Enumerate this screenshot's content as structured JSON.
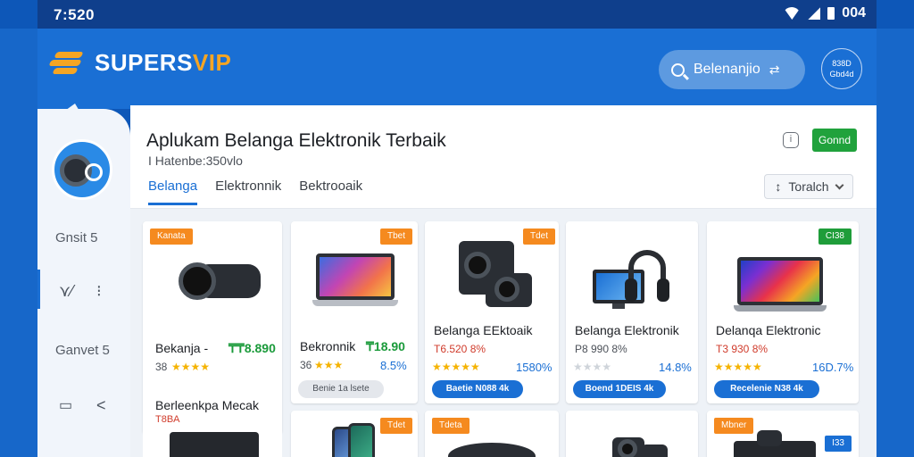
{
  "status": {
    "time": "7:520",
    "battery_text": "004"
  },
  "header": {
    "brand_a": "SUPERS",
    "brand_b": "VIP",
    "search_text": "Belenanjio",
    "account_line1": "838D",
    "account_line2": "Gbd4d"
  },
  "sidebar": {
    "item1": "Gnsit 5",
    "item2": "Ganvet 5"
  },
  "page": {
    "title": "Aplukam Belanga Elektronik Terbaik",
    "subtitle": "I Hatenbe:350vlo",
    "tabs": [
      "Belanga",
      "Elektronnik",
      "Bektrooaik"
    ],
    "action_label": "Gonnd",
    "sort_label": "Toralch"
  },
  "products": [
    {
      "badge": "Kanata",
      "name": "Bekanja -",
      "price": "₸₸8.890",
      "meta": "38",
      "stars": "★★★★"
    },
    {
      "badge": "Tbet",
      "name": "Bekronnik",
      "price": "₸18.90",
      "meta": "36",
      "stars": "★★★",
      "pct": "8.5%",
      "cta": "Benie 1a lsete"
    },
    {
      "badge": "Tdet",
      "name": "Belanga EEktoaik",
      "sub": "T6.520 8%",
      "stars": "★★★★★",
      "pct": "1580%",
      "cta": "Baetie N088 4k"
    },
    {
      "name": "Belanga Elektronik",
      "sub": "P8 990 8%",
      "stars": "★★★★",
      "pct": "14.8%",
      "cta": "Boend 1DEIS 4k"
    },
    {
      "badge": "CI38",
      "name": "Delanqa Elektronic",
      "sub": "T3 930 8%",
      "stars": "★★★★★",
      "pct": "16D.7%",
      "cta": "Recelenie N38 4k"
    },
    {
      "name": "Berleenkpa Mecak",
      "sub": "T8BA"
    },
    {
      "badge": "Tdet"
    },
    {
      "badge": "Tdeta"
    },
    {},
    {
      "badge": "Mbner",
      "badge2": "I33"
    }
  ],
  "colors": {
    "brand": "#1a6fd4",
    "accent": "#f5a524",
    "price": "#1a9a3a"
  }
}
